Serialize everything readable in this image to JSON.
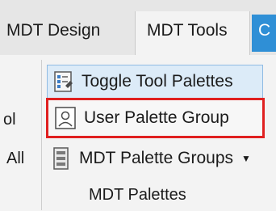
{
  "tabs": {
    "design": "MDT Design",
    "tools": "MDT Tools",
    "next_partial": "C"
  },
  "left_panel": {
    "fragment_top": "ol",
    "fragment_bottom": "All"
  },
  "commands": {
    "toggle_palettes": "Toggle Tool Palettes",
    "user_palette_group": "User Palette Group",
    "mdt_palette_groups": "MDT Palette Groups"
  },
  "panel": {
    "title": "MDT Palettes"
  },
  "colors": {
    "highlight_border": "#e02020",
    "hover_fill": "#dcebf8",
    "active_tab_accent": "#2f8fd6"
  },
  "icons": {
    "toggle": "tool-palette-icon",
    "user": "user-palette-icon",
    "mdt": "palette-group-icon",
    "dropdown": "caret-down-icon"
  }
}
